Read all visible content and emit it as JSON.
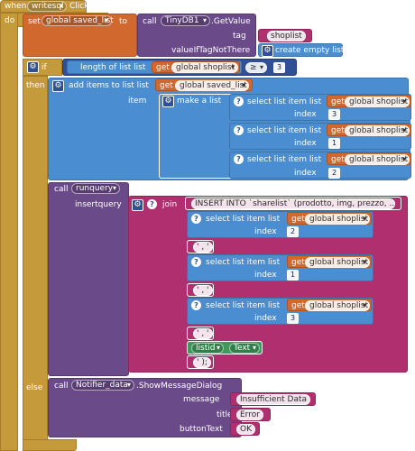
{
  "event": {
    "when_keyword": "when",
    "component": "writesql",
    "dot": ".",
    "event_name": "Click",
    "do_keyword": "do"
  },
  "set_block": {
    "set_keyword": "set",
    "variable": "global saved_list",
    "to_keyword": "to",
    "call_keyword": "call",
    "component": "TinyDB1",
    "method": ".GetValue",
    "tag_label": "tag",
    "tag_value": "shoplist",
    "default_label": "valueIfTagNotThere",
    "default_block": "create empty list"
  },
  "if_block": {
    "if_keyword": "if",
    "length_label": "length of list  list",
    "get_keyword": "get",
    "get_var": "global shoplist",
    "compare_op": "≥",
    "compare_value": "3",
    "then_keyword": "then",
    "else_keyword": "else"
  },
  "add_items": {
    "label": "add items to list  list",
    "get_keyword": "get",
    "list_var": "global saved_list",
    "item_label": "item",
    "make_list": "make a list",
    "select_label": "select list item  list",
    "select_var": "global shoplist",
    "index_label": "index",
    "indexes": [
      "3",
      "1",
      "2"
    ]
  },
  "runquery": {
    "call_keyword": "call",
    "method": "runquery",
    "param_label": "insertquery",
    "join_label": "join",
    "sql_text": "INSERT INTO `sharelist` (prodotto, img, prezzo, ...",
    "select_label": "select list item  list",
    "get_keyword": "get",
    "select_var": "global shoplist",
    "index_label": "index",
    "indexes": [
      "2",
      "1",
      "3"
    ],
    "sep1": "' , '",
    "sep2": "' , '",
    "sep3": "' , '",
    "listid_var": "listid",
    "text_prop": "Text",
    "end_text": "' );"
  },
  "notifier": {
    "call_keyword": "call",
    "component": "Notifier_data",
    "method": ".ShowMessageDialog",
    "message_label": "message",
    "message_value": "Insufficient Data",
    "title_label": "title",
    "title_value": "Error",
    "button_label": "buttonText",
    "button_value": "OK"
  },
  "colors": {
    "event": "#c59a3b",
    "variable": "#d1682d",
    "procedure": "#6a4a88",
    "text": "#b0306f",
    "list": "#4a8ed1",
    "math": "#2f4f96",
    "component": "#3d9a5c"
  }
}
